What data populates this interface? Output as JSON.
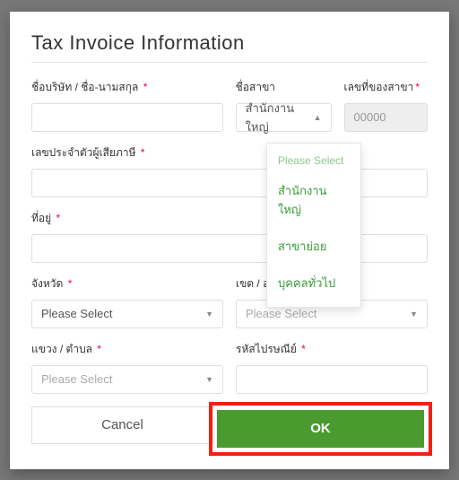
{
  "title": "Tax Invoice Information",
  "fields": {
    "company": {
      "label": "ชื่อบริษัท / ชื่อ-นามสกุล"
    },
    "branch": {
      "label": "ชื่อสาขา",
      "selected": "สำนักงานใหญ่"
    },
    "branchNo": {
      "label": "เลขที่ของสาขา",
      "value": "00000"
    },
    "taxId": {
      "label": "เลขประจำตัวผู้เสียภาษี"
    },
    "address": {
      "label": "ที่อยู่"
    },
    "province": {
      "label": "จังหวัด",
      "placeholder": "Please Select"
    },
    "district": {
      "label": "เขต / อำเภอ",
      "placeholder": "Please Select"
    },
    "subdistrict": {
      "label": "แขวง / ตำบล",
      "placeholder": "Please Select"
    },
    "postcode": {
      "label": "รหัสไปรษณีย์"
    }
  },
  "dropdown": {
    "header": "Please Select",
    "options": [
      "สำนักงานใหญ่",
      "สาขาย่อย",
      "บุคคลทั่วไป"
    ]
  },
  "buttons": {
    "cancel": "Cancel",
    "ok": "OK"
  },
  "required_marker": "*"
}
